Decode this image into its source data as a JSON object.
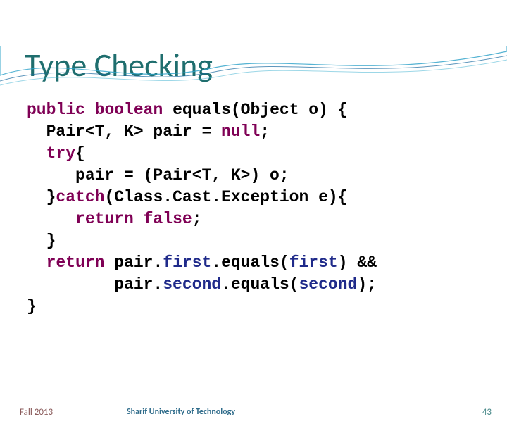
{
  "slide": {
    "title": "Type Checking"
  },
  "code": {
    "l1a": "public",
    "l1b": " ",
    "l1c": "boolean",
    "l1d": " equals(Object o) {",
    "l2a": "  Pair<T, K> pair = ",
    "l2b": "null",
    "l2c": ";",
    "l3a": "  ",
    "l3b": "try",
    "l3c": "{",
    "l4": "     pair = (Pair<T, K>) o;",
    "l5a": "  }",
    "l5b": "catch",
    "l5c": "(Class.Cast.Exception e){",
    "l6a": "     ",
    "l6b": "return",
    "l6c": " ",
    "l6d": "false",
    "l6e": ";",
    "l7": "  }",
    "l8a": "  ",
    "l8b": "return",
    "l8c": " pair.",
    "l8d": "first",
    "l8e": ".equals(",
    "l8f": "first",
    "l8g": ") && ",
    "l9a": "         pair.",
    "l9b": "second",
    "l9c": ".equals(",
    "l9d": "second",
    "l9e": ");",
    "l10": "}"
  },
  "footer": {
    "term": "Fall 2013",
    "org": "Sharif University of Technology",
    "page": "43"
  }
}
